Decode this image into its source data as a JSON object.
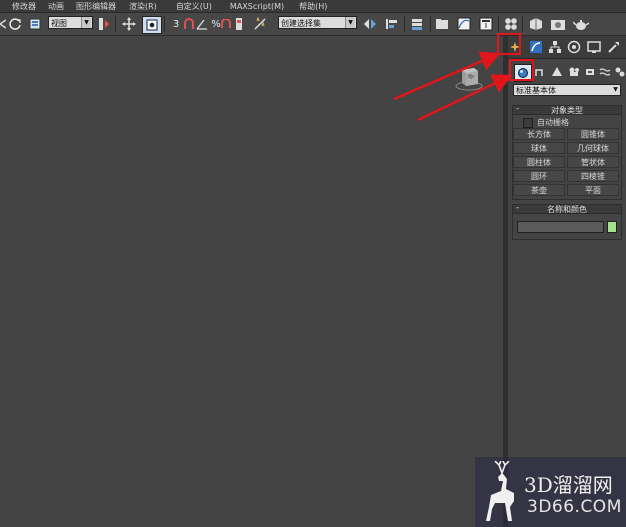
{
  "menubar": {
    "items": [
      "修改器",
      "动画",
      "图形编辑器",
      "渲染(R)",
      "自定义(U)",
      "MAXScript(M)",
      "帮助(H)"
    ]
  },
  "toolbar": {
    "view_dropdown": "视图",
    "percent_snap": "%",
    "angle_snap": "3",
    "selection_set_dropdown": "创建选择集"
  },
  "command_panel": {
    "tabs": [
      "create-icon",
      "modify-icon",
      "hierarchy-icon",
      "motion-icon",
      "display-icon",
      "utilities-icon"
    ],
    "subtabs": [
      "geometry-icon",
      "shapes-icon",
      "lights-icon",
      "cameras-icon",
      "helpers-icon",
      "spacewarps-icon",
      "systems-icon"
    ],
    "category_dropdown": "标准基本体",
    "object_type": {
      "title": "对象类型",
      "autogrid_label": "自动栅格",
      "buttons": [
        "长方体",
        "圆锥体",
        "球体",
        "几何球体",
        "圆柱体",
        "管状体",
        "圆环",
        "四棱锥",
        "茶壶",
        "平面"
      ]
    },
    "name_color": {
      "title": "名称和颜色",
      "name_value": "",
      "color": "#a6e08c"
    }
  },
  "annotations": {
    "highlight_color": "#e0161a"
  },
  "watermark": {
    "brand": "3D溜溜网",
    "url": "3D66.COM"
  }
}
